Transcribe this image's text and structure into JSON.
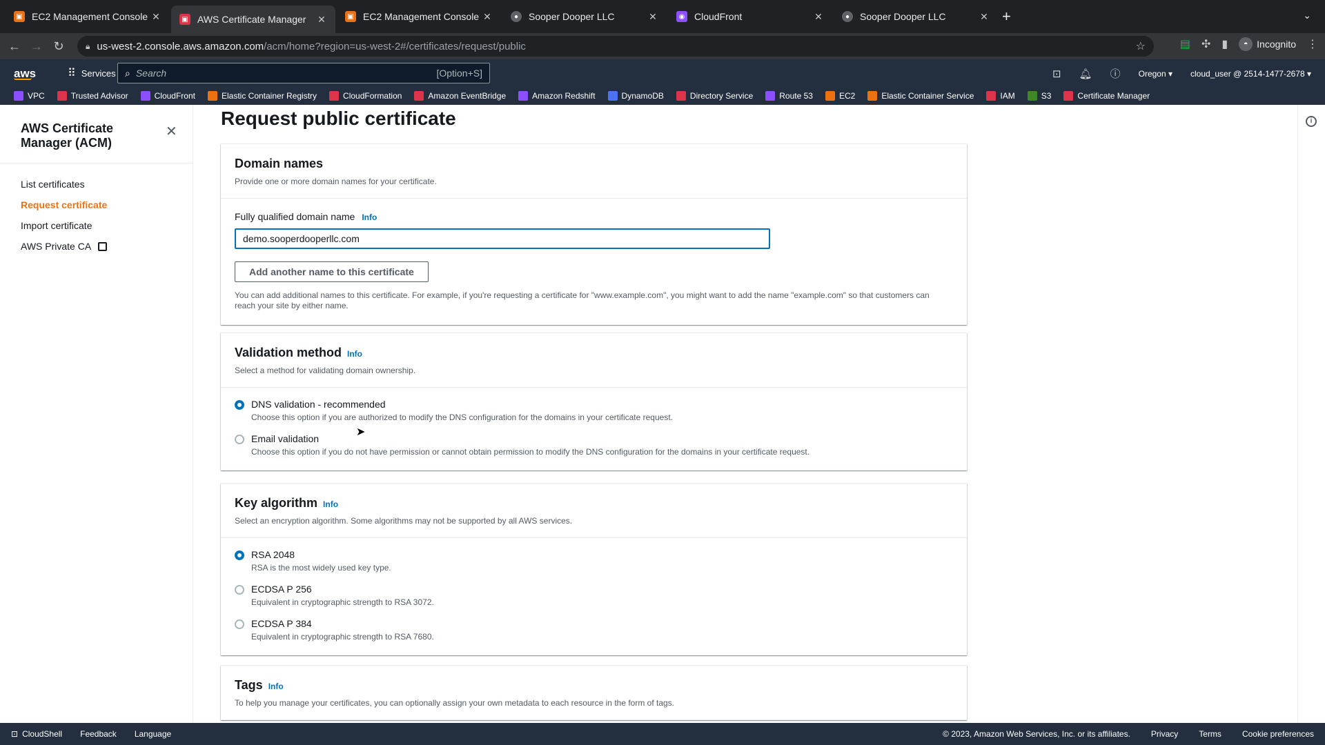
{
  "browser": {
    "tabs": [
      {
        "title": "EC2 Management Console",
        "favicon_color": "#ec7211"
      },
      {
        "title": "AWS Certificate Manager",
        "favicon_color": "#dd344c"
      },
      {
        "title": "EC2 Management Console",
        "favicon_color": "#ec7211"
      },
      {
        "title": "Sooper Dooper LLC",
        "favicon_color": "#9aa0a6"
      },
      {
        "title": "CloudFront",
        "favicon_color": "#8c4fff"
      },
      {
        "title": "Sooper Dooper LLC",
        "favicon_color": "#9aa0a6"
      }
    ],
    "active_tab": 1,
    "url_host": "us-west-2.console.aws.amazon.com",
    "url_path": "/acm/home?region=us-west-2#/certificates/request/public",
    "profile": "Incognito"
  },
  "aws_header": {
    "services_label": "Services",
    "search_placeholder": "Search",
    "search_shortcut": "[Option+S]",
    "region": "Oregon",
    "account": "cloud_user @ 2514-1477-2678"
  },
  "favorites": [
    {
      "label": "VPC",
      "color": "#8c4fff"
    },
    {
      "label": "Trusted Advisor",
      "color": "#dd344c"
    },
    {
      "label": "CloudFront",
      "color": "#8c4fff"
    },
    {
      "label": "Elastic Container Registry",
      "color": "#ec7211"
    },
    {
      "label": "CloudFormation",
      "color": "#dd344c"
    },
    {
      "label": "Amazon EventBridge",
      "color": "#dd344c"
    },
    {
      "label": "Amazon Redshift",
      "color": "#8c4fff"
    },
    {
      "label": "DynamoDB",
      "color": "#4d72f3"
    },
    {
      "label": "Directory Service",
      "color": "#dd344c"
    },
    {
      "label": "Route 53",
      "color": "#8c4fff"
    },
    {
      "label": "EC2",
      "color": "#ec7211"
    },
    {
      "label": "Elastic Container Service",
      "color": "#ec7211"
    },
    {
      "label": "IAM",
      "color": "#dd344c"
    },
    {
      "label": "S3",
      "color": "#3f8624"
    },
    {
      "label": "Certificate Manager",
      "color": "#dd344c"
    }
  ],
  "sidebar": {
    "title": "AWS Certificate Manager (ACM)",
    "items": [
      {
        "label": "List certificates"
      },
      {
        "label": "Request certificate"
      },
      {
        "label": "Import certificate"
      },
      {
        "label": "AWS Private CA"
      }
    ],
    "active_index": 1
  },
  "main": {
    "page_title": "Request public certificate",
    "domain_names": {
      "heading": "Domain names",
      "description": "Provide one or more domain names for your certificate.",
      "field_label": "Fully qualified domain name",
      "info": "Info",
      "field_value": "demo.sooperdooperllc.com",
      "add_button": "Add another name to this certificate",
      "help": "You can add additional names to this certificate. For example, if you're requesting a certificate for \"www.example.com\", you might want to add the name \"example.com\" so that customers can reach your site by either name."
    },
    "validation": {
      "heading": "Validation method",
      "info": "Info",
      "description": "Select a method for validating domain ownership.",
      "options": [
        {
          "label": "DNS validation - recommended",
          "desc": "Choose this option if you are authorized to modify the DNS configuration for the domains in your certificate request."
        },
        {
          "label": "Email validation",
          "desc": "Choose this option if you do not have permission or cannot obtain permission to modify the DNS configuration for the domains in your certificate request."
        }
      ],
      "selected": 0
    },
    "key_algorithm": {
      "heading": "Key algorithm",
      "info": "Info",
      "description": "Select an encryption algorithm. Some algorithms may not be supported by all AWS services.",
      "options": [
        {
          "label": "RSA 2048",
          "desc": "RSA is the most widely used key type."
        },
        {
          "label": "ECDSA P 256",
          "desc": "Equivalent in cryptographic strength to RSA 3072."
        },
        {
          "label": "ECDSA P 384",
          "desc": "Equivalent in cryptographic strength to RSA 7680."
        }
      ],
      "selected": 0
    },
    "tags": {
      "heading": "Tags",
      "info": "Info",
      "description": "To help you manage your certificates, you can optionally assign your own metadata to each resource in the form of tags."
    }
  },
  "footer": {
    "cloudshell": "CloudShell",
    "feedback": "Feedback",
    "language": "Language",
    "copyright": "© 2023, Amazon Web Services, Inc. or its affiliates.",
    "privacy": "Privacy",
    "terms": "Terms",
    "cookies": "Cookie preferences"
  }
}
